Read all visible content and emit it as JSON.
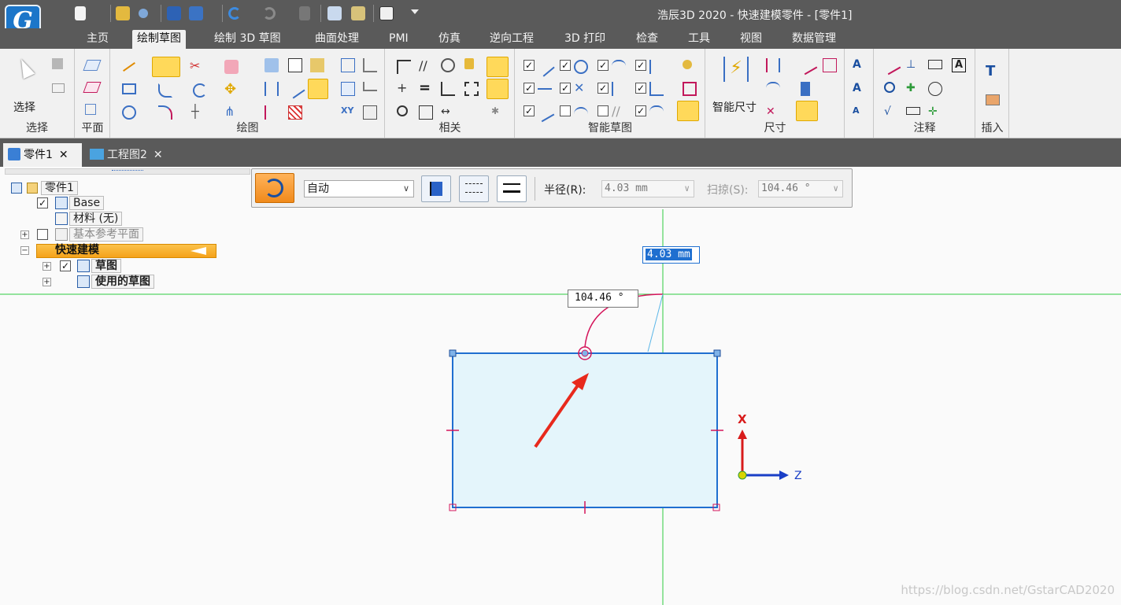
{
  "app": {
    "logo_letter": "G",
    "window_title": "浩辰3D 2020 - 快速建模零件 - [零件1]"
  },
  "menu": {
    "tabs": [
      "主页",
      "绘制草图",
      "绘制 3D 草图",
      "曲面处理",
      "PMI",
      "仿真",
      "逆向工程",
      "3D 打印",
      "检查",
      "工具",
      "视图",
      "数据管理"
    ],
    "active_tab": "绘制草图"
  },
  "ribbon": {
    "groups": {
      "select": "选择",
      "plane": "平面",
      "draw": "绘图",
      "relate": "相关",
      "smart_sketch": "智能草图",
      "dimension": "尺寸",
      "annotation": "注释",
      "insert": "插入"
    },
    "select_label": "选择",
    "smart_dim_label": "智能尺寸"
  },
  "doc_tabs": [
    {
      "label": "零件1",
      "active": true
    },
    {
      "label": "工程图2",
      "active": false
    }
  ],
  "tree": {
    "root": "零件1",
    "base": "Base",
    "material": "材料 (无)",
    "ref_planes": "基本参考平面",
    "mode": "快速建模",
    "sketch": "草图",
    "used_sketch": "使用的草图"
  },
  "command_bar": {
    "mode_value": "自动",
    "radius_label": "半径(R):",
    "radius_value": "4.03 mm",
    "sweep_label": "扫掠(S):",
    "sweep_value": "104.46 °"
  },
  "canvas": {
    "dim_radius": "4.03 mm",
    "dim_angle": "104.46 °",
    "axis_x": "X",
    "axis_z": "Z",
    "watermark": "https://blog.csdn.net/GstarCAD2020"
  },
  "colors": {
    "accent": "#ffd95a",
    "sketch_line": "#1f6fd0",
    "highlight": "#d4145a",
    "grid_line": "#2ecc40"
  }
}
